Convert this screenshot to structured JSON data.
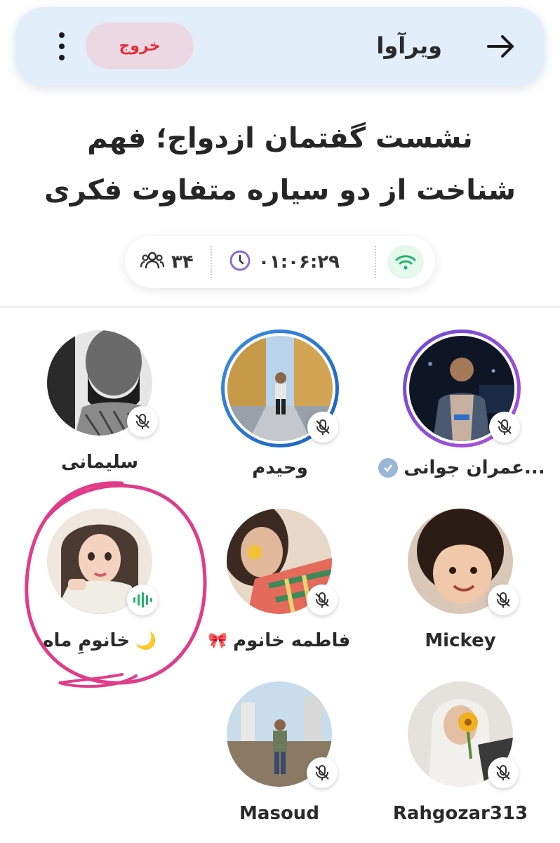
{
  "header": {
    "title": "ویرآوا",
    "exit_label": "خروج",
    "icons": [
      "more-vertical-icon",
      "arrow-right-icon"
    ]
  },
  "room": {
    "title_line1": "نشست گفتمان ازدواج؛ فهم",
    "title_line2": "شناخت از دو سیاره متفاوت فکری"
  },
  "stats": {
    "listeners": "۳۴",
    "timer": "۰۱:۰۶:۲۹",
    "icons": [
      "users-icon",
      "clock-icon",
      "wifi-icon"
    ],
    "connection_color": "#22b56b"
  },
  "participants": [
    {
      "name": "عمران جوانی...",
      "verified": true,
      "status": "muted",
      "ring": "purple"
    },
    {
      "name": "وحیدم",
      "verified": false,
      "status": "muted",
      "ring": "blue"
    },
    {
      "name": "سلیمانی",
      "verified": false,
      "status": "muted",
      "ring": "none"
    },
    {
      "name": "Mickey",
      "verified": false,
      "status": "muted",
      "ring": "none"
    },
    {
      "name": "فاطمه خانوم",
      "emoji": "🎀",
      "verified": false,
      "status": "muted",
      "ring": "none"
    },
    {
      "name": "خانومِ ماه",
      "emoji": "🌙",
      "verified": false,
      "status": "speaking",
      "ring": "none"
    },
    {
      "name": "Rahgozar313",
      "verified": false,
      "status": "muted",
      "ring": "none"
    },
    {
      "name": "Masoud",
      "verified": false,
      "status": "muted",
      "ring": "none"
    }
  ],
  "colors": {
    "header_bg": "#e3eefb",
    "exit_text": "#e2303a",
    "exit_bg": "#ecd8e3",
    "speaking": "#22b56b",
    "annotation": "#e03c8a"
  }
}
